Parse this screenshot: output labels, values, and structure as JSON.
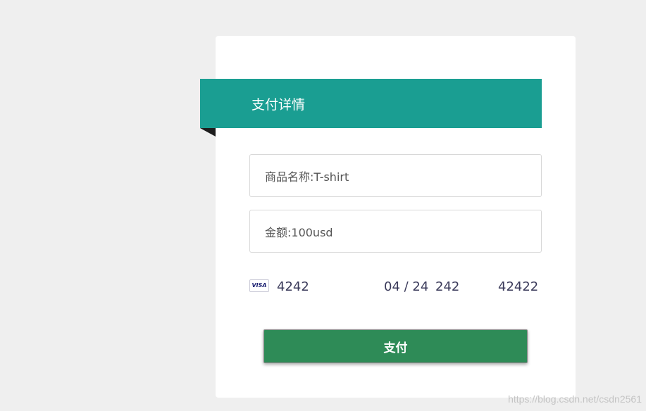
{
  "header": {
    "title": "支付详情"
  },
  "fields": {
    "product": "商品名称:T-shirt",
    "amount": "金额:100usd"
  },
  "card": {
    "brand_icon": "visa-icon",
    "brand_label": "VISA",
    "number": "4242",
    "expiry": "04 / 24",
    "cvc": "242",
    "zip": "42422"
  },
  "pay_button": {
    "label": "支付"
  },
  "watermark": "https://blog.csdn.net/csdn2561",
  "colors": {
    "header": "#1a9e92",
    "button": "#2e8b57",
    "background": "#efefef"
  }
}
